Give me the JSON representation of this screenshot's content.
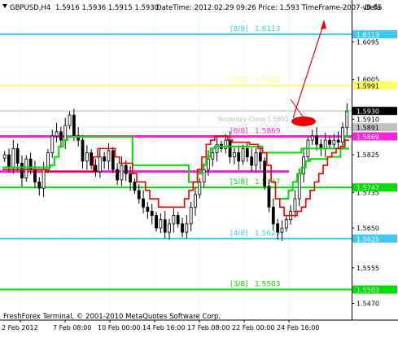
{
  "window": {
    "symbol": "GBPUSD,H4",
    "ohlc": "1.5916 1.5936 1.5915 1.5930",
    "info": "DateTime: 2012.02.29 09:26   Price: 1.593   TimeFrame-2007-v0.05",
    "info_cut": "Defa",
    "copyright": "FreshForex Terminal, © 2001-2010 MetaQuotes Software Corp.",
    "yesterday_label": "Yesterday Close 1.5891"
  },
  "colors": {
    "background": "#ffffff",
    "candle": "#000000",
    "cyan_level": "#3ec8f5",
    "yellow_level": "#ffff66",
    "green_level": "#00dd00",
    "magenta_level": "#ff22dd",
    "red_line": "#ee0000",
    "green_line": "#00cc00",
    "arrow": "#ee0000"
  },
  "chart_data": {
    "type": "candlestick",
    "title": "GBPUSD,H4",
    "ylim": [
      1.543,
      1.616
    ],
    "x_ticks": [
      "2 Feb 2012",
      "7 Feb 08:00",
      "10 Feb 00:00",
      "14 Feb 16:00",
      "17 Feb 08:00",
      "22 Feb 00:00",
      "24 Feb 16:00"
    ],
    "y_ticks": [
      "1.6095",
      "1.6005",
      "1.5910",
      "1.5825",
      "1.5735",
      "1.5650",
      "1.5555",
      "1.5470"
    ],
    "price_tags": [
      {
        "label": "1.6113",
        "value": 1.6113,
        "color": "#3ec8f5"
      },
      {
        "label": "1.5991",
        "value": 1.5991,
        "color": "#ffff66"
      },
      {
        "label": "1.5930",
        "value": 1.593,
        "color": "#000000"
      },
      {
        "label": "1.5891",
        "value": 1.5891,
        "color": "#c0c0c0"
      },
      {
        "label": "1.5869",
        "value": 1.5869,
        "color": "#ff22dd"
      },
      {
        "label": "1.5747",
        "value": 1.5747,
        "color": "#00dd00"
      },
      {
        "label": "1.5625",
        "value": 1.5625,
        "color": "#3ec8f5"
      },
      {
        "label": "1.5503",
        "value": 1.5503,
        "color": "#00dd00"
      }
    ],
    "murrey_levels": [
      {
        "name": "[8/8]",
        "label": "1.6113",
        "value": 1.6113,
        "color": "#3ec8f5"
      },
      {
        "name": "[7/8]",
        "label": "1.5991",
        "value": 1.5991,
        "color": "#ffff66"
      },
      {
        "name": "[6/8]",
        "label": "1.5869",
        "value": 1.5869,
        "color": "#ff22dd"
      },
      {
        "name": "[5/8]",
        "label": "1.5747",
        "value": 1.5747,
        "color": "#00dd00"
      },
      {
        "name": "[4/8]",
        "label": "1.5625",
        "value": 1.5625,
        "color": "#3ec8f5"
      },
      {
        "name": "[3/8]",
        "label": "1.5503",
        "value": 1.5503,
        "color": "#00dd00"
      }
    ],
    "secondary_lines": [
      {
        "value": 1.593,
        "color": "#b0b0b0"
      },
      {
        "value": 1.5891,
        "color": "#e6e6e6"
      }
    ],
    "magenta_line_2": 1.5785,
    "close_series": [
      1.5825,
      1.5795,
      1.584,
      1.5805,
      1.577,
      1.5815,
      1.579,
      1.576,
      1.5745,
      1.579,
      1.583,
      1.587,
      1.588,
      1.586,
      1.5895,
      1.592,
      1.587,
      1.586,
      1.581,
      1.583,
      1.58,
      1.5785,
      1.582,
      1.581,
      1.5835,
      1.579,
      1.5765,
      1.58,
      1.578,
      1.576,
      1.574,
      1.572,
      1.57,
      1.569,
      1.568,
      1.565,
      1.567,
      1.564,
      1.566,
      1.568,
      1.566,
      1.564,
      1.566,
      1.57,
      1.573,
      1.576,
      1.579,
      1.5815,
      1.583,
      1.585,
      1.584,
      1.586,
      1.582,
      1.583,
      1.581,
      1.584,
      1.582,
      1.58,
      1.583,
      1.581,
      1.575,
      1.57,
      1.566,
      1.564,
      1.565,
      1.567,
      1.569,
      1.572,
      1.578,
      1.582,
      1.586,
      1.587,
      1.585,
      1.584,
      1.586,
      1.585,
      1.586,
      1.5855,
      1.589,
      1.593
    ],
    "red_trail": [
      1.579,
      1.579,
      1.579,
      1.579,
      1.579,
      1.579,
      1.579,
      1.579,
      1.579,
      1.579,
      1.5785,
      1.5785,
      1.5785,
      1.5785,
      1.5785,
      1.5785,
      1.5785,
      1.5785,
      1.5785,
      1.5785,
      1.5785,
      1.582,
      1.584,
      1.584,
      1.584,
      1.584,
      1.582,
      1.5805,
      1.5805,
      1.5805,
      1.578,
      1.576,
      1.576,
      1.574,
      1.572,
      1.572,
      1.57,
      1.57,
      1.57,
      1.57,
      1.57,
      1.57,
      1.572,
      1.574,
      1.576,
      1.579,
      1.582,
      1.585,
      1.586,
      1.587,
      1.587,
      1.587,
      1.586,
      1.5855,
      1.5855,
      1.5855,
      1.5855,
      1.585,
      1.585,
      1.584,
      1.583,
      1.58,
      1.576,
      1.572,
      1.57,
      1.568,
      1.568,
      1.568,
      1.569,
      1.57,
      1.572,
      1.574,
      1.576,
      1.578,
      1.58,
      1.582,
      1.583,
      1.584,
      1.5845,
      1.586
    ],
    "green_trail": [
      1.5795,
      1.5795,
      1.5795,
      1.5795,
      1.5795,
      1.5795,
      1.5795,
      1.5795,
      1.5795,
      1.5795,
      1.5795,
      1.58,
      1.582,
      1.5845,
      1.586,
      1.5868,
      1.5868,
      1.5868,
      1.5868,
      1.5868,
      1.5868,
      1.5868,
      1.5868,
      1.5868,
      1.5868,
      1.5868,
      1.5868,
      1.5868,
      1.5868,
      1.5868,
      1.58,
      1.58,
      1.58,
      1.58,
      1.58,
      1.58,
      1.58,
      1.58,
      1.58,
      1.58,
      1.58,
      1.58,
      1.58,
      1.576,
      1.576,
      1.578,
      1.58,
      1.582,
      1.584,
      1.5845,
      1.5845,
      1.5845,
      1.5845,
      1.5845,
      1.5845,
      1.5845,
      1.5845,
      1.5845,
      1.5845,
      1.5845,
      1.583,
      1.583,
      1.583,
      1.583,
      1.583,
      1.583,
      1.583,
      1.583,
      1.583,
      1.584,
      1.584,
      1.584,
      1.584,
      1.584,
      1.584,
      1.584,
      1.584,
      1.584,
      1.584,
      1.584
    ],
    "green_trail_2": [
      null,
      null,
      null,
      null,
      null,
      null,
      null,
      null,
      null,
      null,
      null,
      null,
      null,
      null,
      null,
      null,
      null,
      null,
      null,
      null,
      null,
      null,
      null,
      null,
      null,
      null,
      null,
      null,
      null,
      null,
      null,
      null,
      null,
      null,
      null,
      null,
      null,
      null,
      null,
      null,
      null,
      null,
      null,
      null,
      null,
      null,
      null,
      null,
      null,
      null,
      null,
      null,
      null,
      null,
      null,
      null,
      null,
      null,
      null,
      null,
      null,
      null,
      null,
      null,
      1.572,
      1.572,
      1.574,
      1.576,
      1.578,
      1.5795,
      1.581,
      1.5815,
      1.5815,
      1.5815,
      1.5815,
      1.582,
      1.582,
      1.582,
      1.584,
      1.587
    ]
  }
}
